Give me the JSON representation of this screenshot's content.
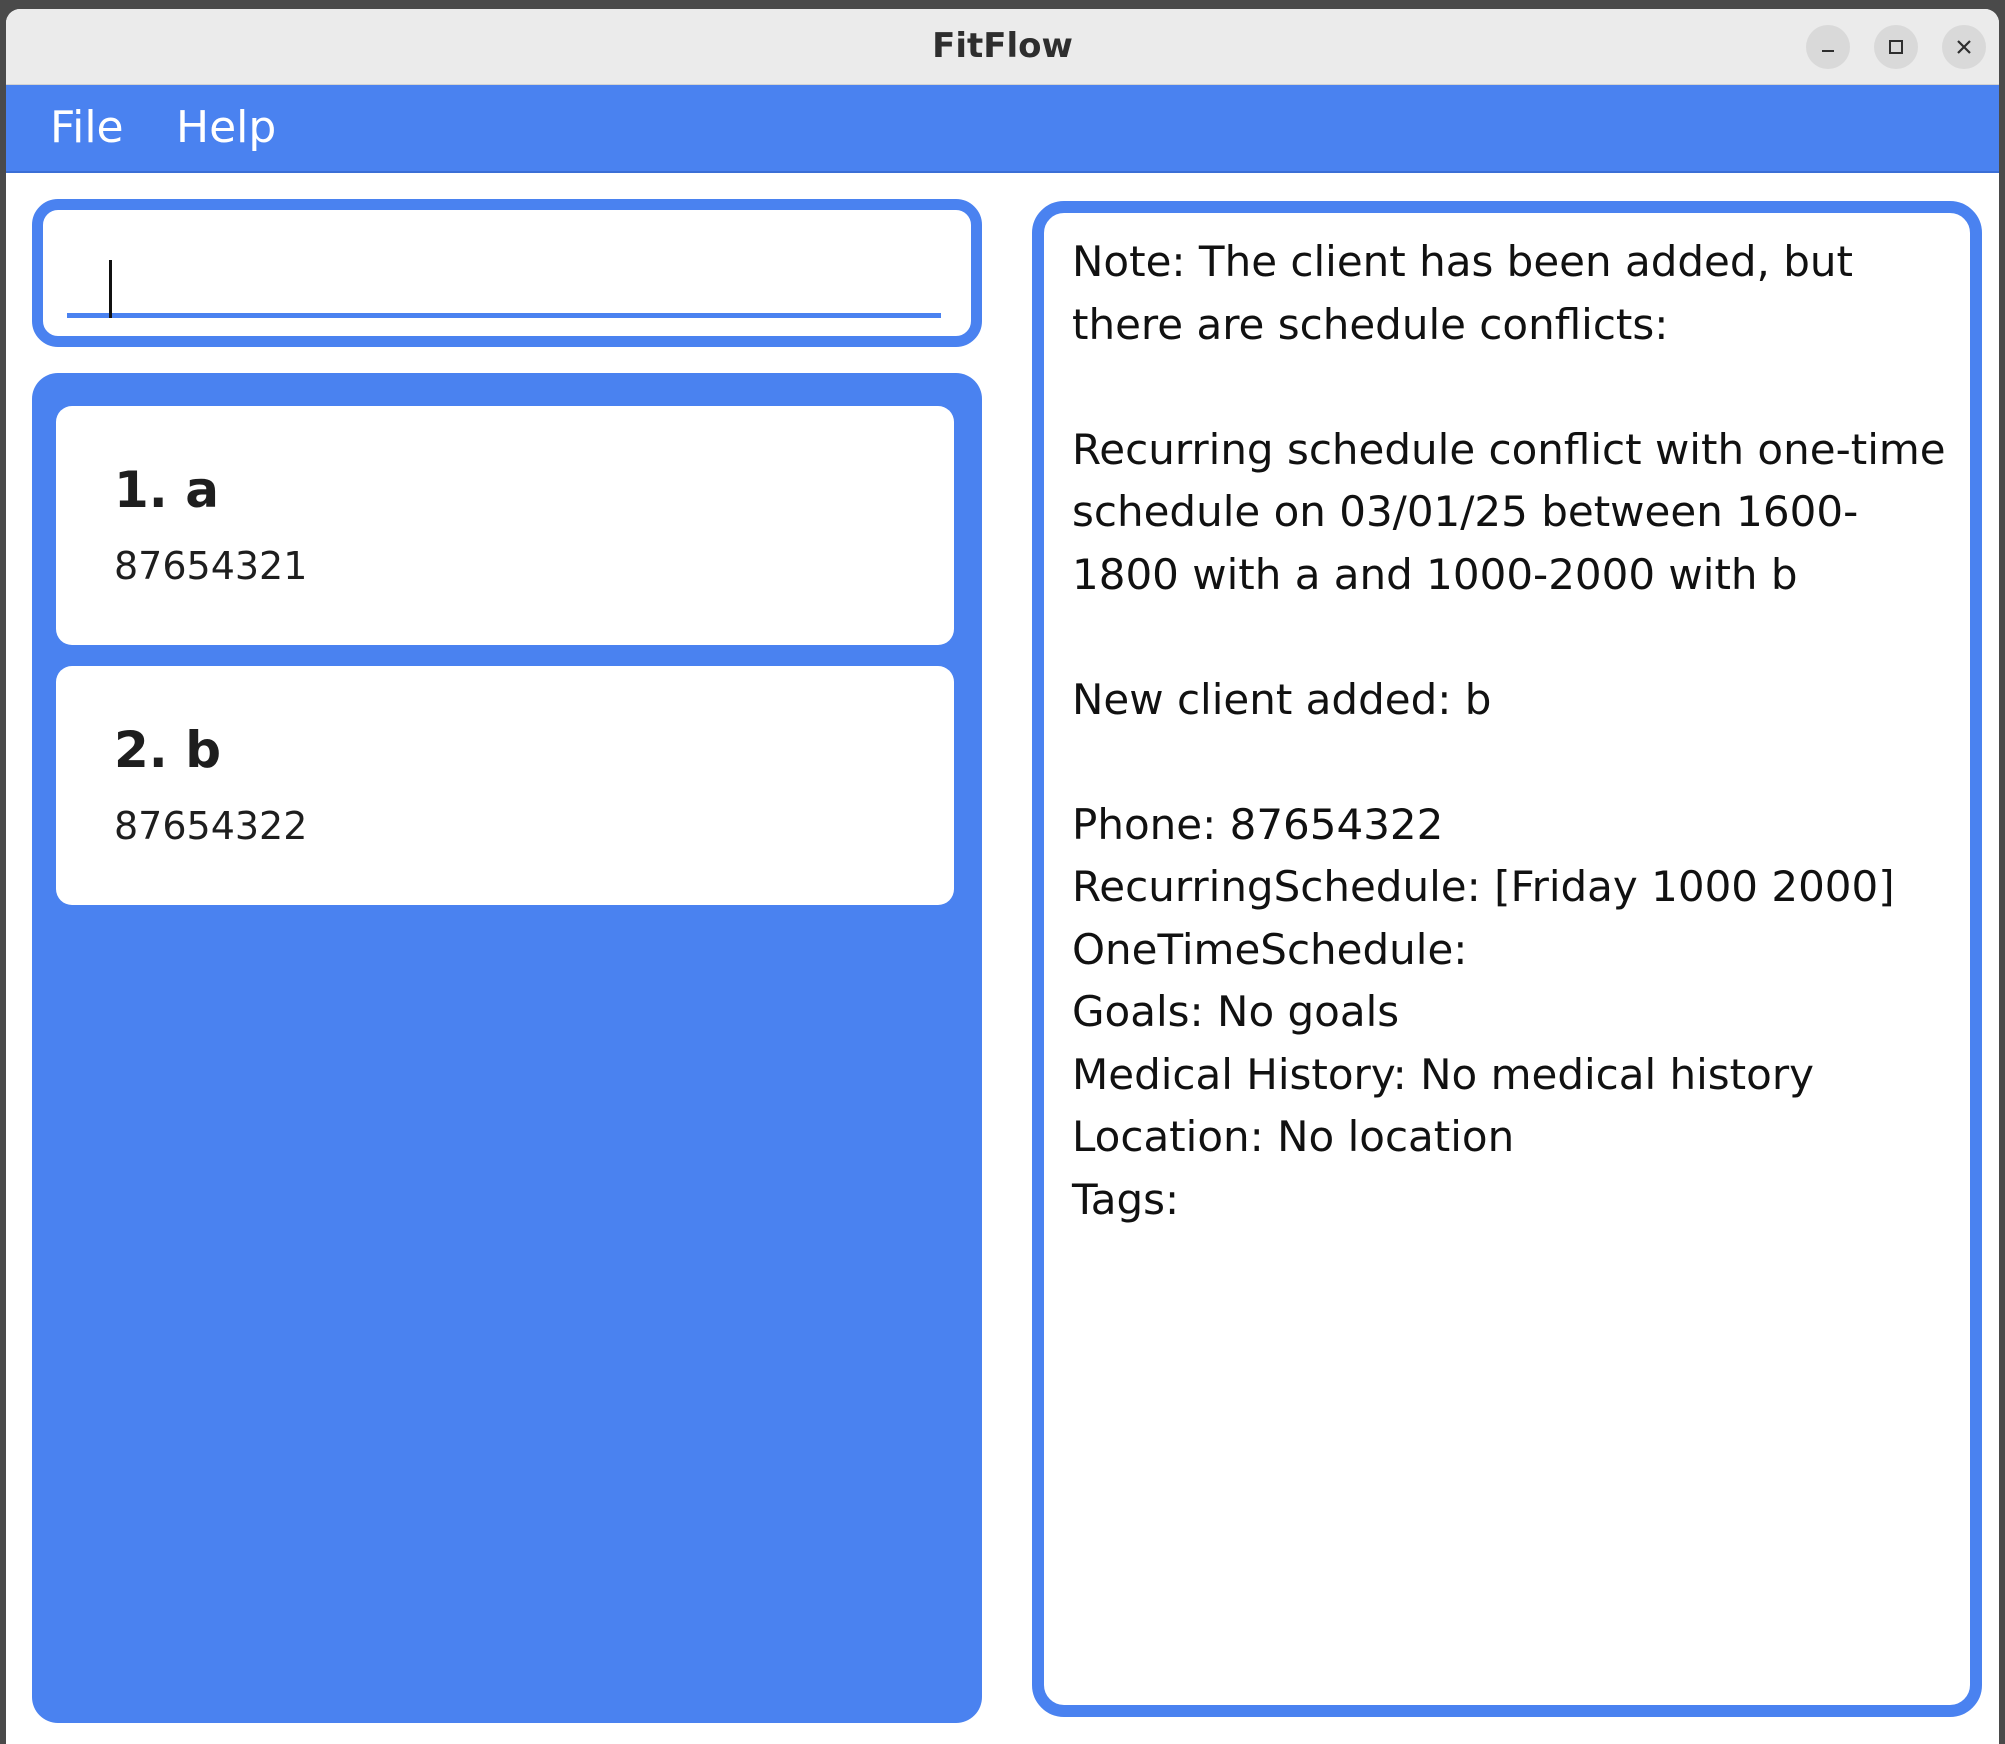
{
  "window": {
    "title": "FitFlow",
    "controls": {
      "minimize_icon": "minimize-icon",
      "maximize_icon": "maximize-icon",
      "close_icon": "close-icon"
    }
  },
  "menubar": {
    "items": [
      {
        "label": "File"
      },
      {
        "label": "Help"
      }
    ]
  },
  "command_box": {
    "value": "",
    "placeholder": ""
  },
  "client_list": {
    "items": [
      {
        "title": "1. a",
        "phone": "87654321"
      },
      {
        "title": "2. b",
        "phone": "87654322"
      }
    ]
  },
  "result_display": {
    "text": "Note: The client has been added, but there are schedule conflicts:\n\nRecurring schedule conflict with one-time schedule on 03/01/25 between 1600-1800 with a and 1000-2000 with b\n\nNew client added: b\n\nPhone: 87654322\nRecurringSchedule: [Friday 1000 2000]\nOneTimeSchedule: \nGoals: No goals\nMedical History: No medical history\nLocation: No location\nTags: "
  },
  "colors": {
    "accent": "#4a82f0",
    "titlebar": "#ebebeb",
    "text": "#111111"
  }
}
